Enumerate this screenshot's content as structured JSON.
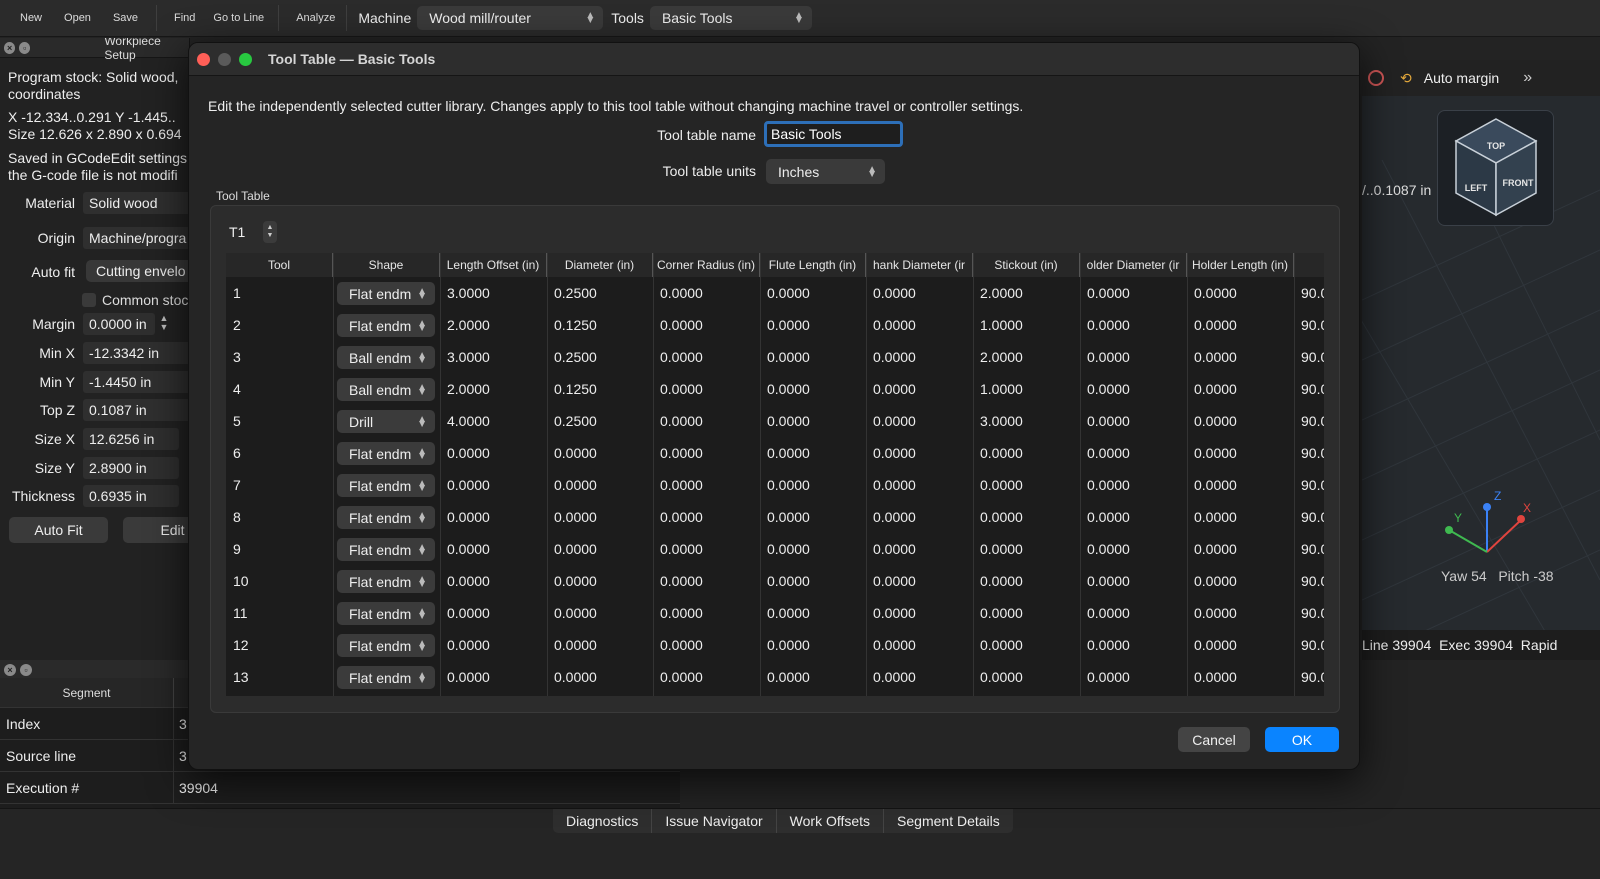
{
  "toolbar": {
    "buttons": [
      "New",
      "Open",
      "Save",
      "Find",
      "Go to Line",
      "Analyze"
    ],
    "machine_label": "Machine",
    "machine_value": "Wood mill/router",
    "tools_label": "Tools",
    "tools_value": "Basic Tools"
  },
  "workpiece": {
    "title": "Workpiece Setup",
    "stock_line1": "Program stock: Solid wood,",
    "stock_line2": "coordinates",
    "bounds": "X -12.334..0.291  Y -1.445..",
    "size": "Size 12.626 x 2.890 x 0.694",
    "saved_line1": "Saved in GCodeEdit settings",
    "saved_line2": "the G-code file is not modifi",
    "material_label": "Material",
    "material_value": "Solid wood",
    "origin_label": "Origin",
    "origin_value": "Machine/progra",
    "autofit_label": "Auto fit",
    "autofit_value": "Cutting envelo",
    "common_stock": "Common stoc",
    "margin_label": "Margin",
    "margin_value": "0.0000 in",
    "minx_label": "Min X",
    "minx_value": "-12.3342 in",
    "miny_label": "Min Y",
    "miny_value": "-1.4450 in",
    "topz_label": "Top Z",
    "topz_value": "0.1087 in",
    "sizex_label": "Size X",
    "sizex_value": "12.6256 in",
    "sizey_label": "Size Y",
    "sizey_value": "2.8900 in",
    "thickness_label": "Thickness",
    "thickness_value": "0.6935 in",
    "autofit_button": "Auto Fit",
    "edit_button": "Edit"
  },
  "viewport": {
    "auto_margin": "Auto margin",
    "coord_readout": "/..0.1087 in",
    "cube_top": "TOP",
    "cube_left": "LEFT",
    "cube_front": "FRONT",
    "axis_x": "X",
    "axis_y": "Y",
    "axis_z": "Z",
    "yaw_pitch": "Yaw 54   Pitch -38",
    "exec_status": "Line 39904  Exec 39904  Rapid"
  },
  "segment": {
    "header": "Segment",
    "rows": [
      {
        "label": "Index",
        "value": "3"
      },
      {
        "label": "Source line",
        "value": "3"
      },
      {
        "label": "Execution #",
        "value": "39904"
      }
    ]
  },
  "bottom_tabs": [
    "Diagnostics",
    "Issue Navigator",
    "Work Offsets",
    "Segment Details"
  ],
  "dialog": {
    "title": "Tool Table — Basic Tools",
    "description": "Edit the independently selected cutter library. Changes apply to this tool table without changing machine travel or controller settings.",
    "name_label": "Tool table name",
    "name_value": "Basic Tools",
    "units_label": "Tool table units",
    "units_value": "Inches",
    "group_label": "Tool Table",
    "selected_tool": "T1",
    "columns": [
      "Tool",
      "Shape",
      "Length Offset (in)",
      "Diameter (in)",
      "Corner Radius (in)",
      "Flute Length (in)",
      "hank Diameter (ir",
      "Stickout (in)",
      "older Diameter (ir",
      "Holder Length (in)",
      ""
    ],
    "rows": [
      [
        "1",
        "Flat endm",
        "3.0000",
        "0.2500",
        "0.0000",
        "0.0000",
        "0.0000",
        "2.0000",
        "0.0000",
        "0.0000",
        "90.0"
      ],
      [
        "2",
        "Flat endm",
        "2.0000",
        "0.1250",
        "0.0000",
        "0.0000",
        "0.0000",
        "1.0000",
        "0.0000",
        "0.0000",
        "90.0"
      ],
      [
        "3",
        "Ball endm",
        "3.0000",
        "0.2500",
        "0.0000",
        "0.0000",
        "0.0000",
        "2.0000",
        "0.0000",
        "0.0000",
        "90.0"
      ],
      [
        "4",
        "Ball endm",
        "2.0000",
        "0.1250",
        "0.0000",
        "0.0000",
        "0.0000",
        "1.0000",
        "0.0000",
        "0.0000",
        "90.0"
      ],
      [
        "5",
        "Drill",
        "4.0000",
        "0.2500",
        "0.0000",
        "0.0000",
        "0.0000",
        "3.0000",
        "0.0000",
        "0.0000",
        "90.0"
      ],
      [
        "6",
        "Flat endm",
        "0.0000",
        "0.0000",
        "0.0000",
        "0.0000",
        "0.0000",
        "0.0000",
        "0.0000",
        "0.0000",
        "90.0"
      ],
      [
        "7",
        "Flat endm",
        "0.0000",
        "0.0000",
        "0.0000",
        "0.0000",
        "0.0000",
        "0.0000",
        "0.0000",
        "0.0000",
        "90.0"
      ],
      [
        "8",
        "Flat endm",
        "0.0000",
        "0.0000",
        "0.0000",
        "0.0000",
        "0.0000",
        "0.0000",
        "0.0000",
        "0.0000",
        "90.0"
      ],
      [
        "9",
        "Flat endm",
        "0.0000",
        "0.0000",
        "0.0000",
        "0.0000",
        "0.0000",
        "0.0000",
        "0.0000",
        "0.0000",
        "90.0"
      ],
      [
        "10",
        "Flat endm",
        "0.0000",
        "0.0000",
        "0.0000",
        "0.0000",
        "0.0000",
        "0.0000",
        "0.0000",
        "0.0000",
        "90.0"
      ],
      [
        "11",
        "Flat endm",
        "0.0000",
        "0.0000",
        "0.0000",
        "0.0000",
        "0.0000",
        "0.0000",
        "0.0000",
        "0.0000",
        "90.0"
      ],
      [
        "12",
        "Flat endm",
        "0.0000",
        "0.0000",
        "0.0000",
        "0.0000",
        "0.0000",
        "0.0000",
        "0.0000",
        "0.0000",
        "90.0"
      ],
      [
        "13",
        "Flat endm",
        "0.0000",
        "0.0000",
        "0.0000",
        "0.0000",
        "0.0000",
        "0.0000",
        "0.0000",
        "0.0000",
        "90.0"
      ]
    ],
    "cancel_label": "Cancel",
    "ok_label": "OK"
  },
  "colors": {
    "accent": "#0a84ff",
    "traffic_red": "#ff5f57",
    "traffic_gray": "#5a5a5a",
    "traffic_green": "#28c840",
    "axis_x": "#e0443e",
    "axis_y": "#3fb950",
    "axis_z": "#3b82f6"
  }
}
